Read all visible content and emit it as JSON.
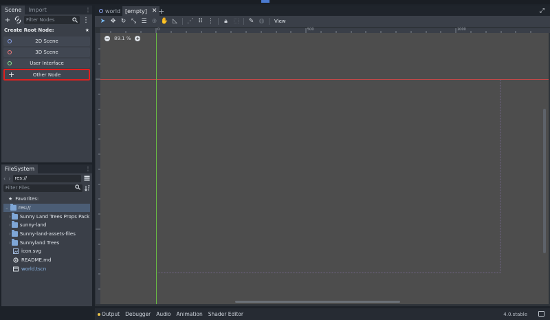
{
  "scene_dock": {
    "tabs": [
      {
        "label": "Scene"
      },
      {
        "label": "Import"
      }
    ],
    "filter_placeholder": "Filter Nodes",
    "create_root_label": "Create Root Node:",
    "root_buttons": [
      {
        "label": "2D Scene",
        "color": "#8da5f3"
      },
      {
        "label": "3D Scene",
        "color": "#fc7f7f"
      },
      {
        "label": "User Interface",
        "color": "#8eef97"
      }
    ],
    "other_node_label": "Other Node"
  },
  "filesystem": {
    "tab_label": "FileSystem",
    "path": "res://",
    "filter_placeholder": "Filter Files",
    "favorites_label": "Favorites:",
    "items": [
      {
        "label": "res://",
        "type": "root"
      },
      {
        "label": "Sunny Land Trees Props Pack",
        "type": "folder"
      },
      {
        "label": "sunny-land",
        "type": "folder"
      },
      {
        "label": "Sunny-land-assets-files",
        "type": "folder"
      },
      {
        "label": "Sunnyland Trees",
        "type": "folder"
      },
      {
        "label": "icon.svg",
        "type": "image"
      },
      {
        "label": "README.md",
        "type": "text"
      },
      {
        "label": "world.tscn",
        "type": "scene"
      }
    ]
  },
  "scene_tabs": [
    {
      "label": "world",
      "active": false
    },
    {
      "label": "[empty]",
      "active": true
    }
  ],
  "viewport_toolbar": {
    "view_label": "View"
  },
  "rulers": {
    "tick_labels": [
      "0",
      "500",
      "1000"
    ]
  },
  "viewport": {
    "zoom_level": "89.1 %"
  },
  "bottom_panel": {
    "tabs": [
      "Output",
      "Debugger",
      "Audio",
      "Animation",
      "Shader Editor"
    ],
    "version": "4.0.stable"
  },
  "colors": {
    "accent_selection": "#4b5d75",
    "highlight_box": "#e02020",
    "output_dot": "#e8c24a"
  }
}
